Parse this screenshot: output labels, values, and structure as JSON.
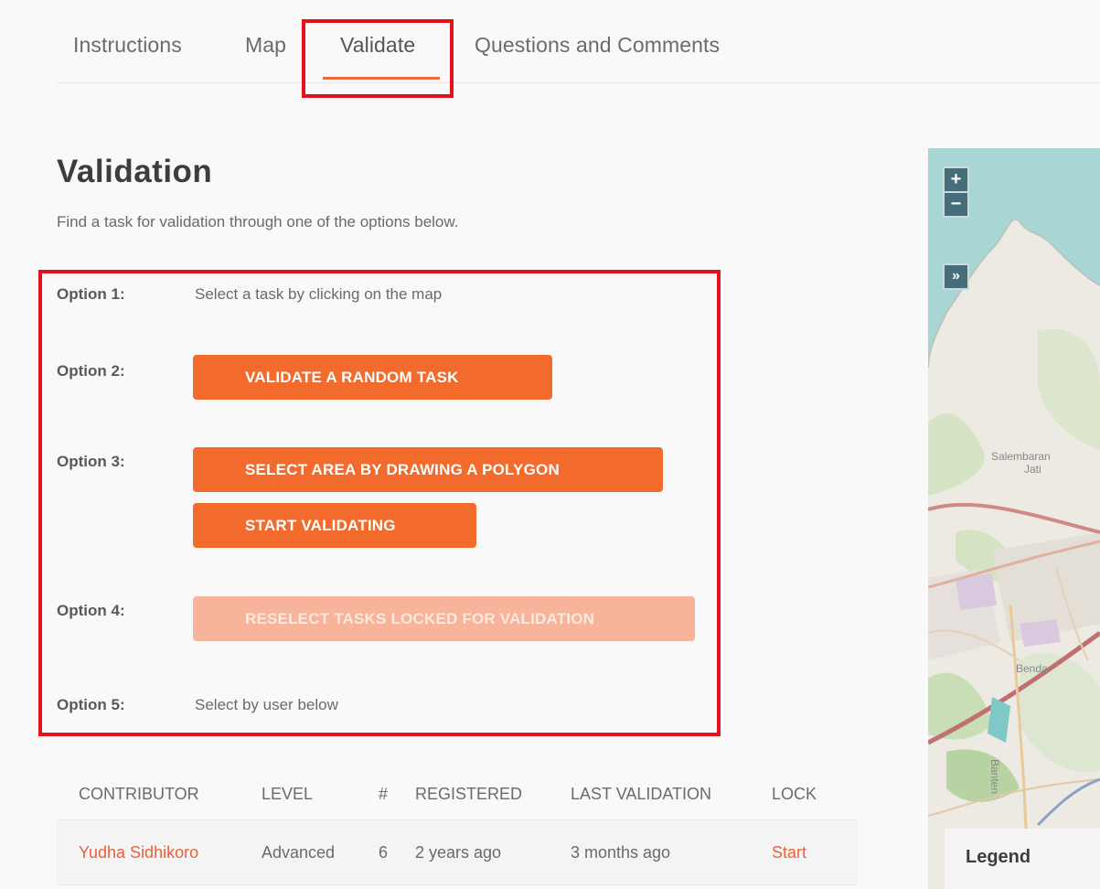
{
  "tabs": [
    {
      "label": "Instructions"
    },
    {
      "label": "Map"
    },
    {
      "label": "Validate"
    },
    {
      "label": "Questions and Comments"
    }
  ],
  "active_tab": "Validate",
  "validation": {
    "title": "Validation",
    "subtitle": "Find a task for validation through one of the options below.",
    "options": [
      {
        "label": "Option 1:",
        "text": "Select a task by clicking on the map"
      },
      {
        "label": "Option 2:",
        "button": "VALIDATE A RANDOM TASK"
      },
      {
        "label": "Option 3:",
        "button": "SELECT AREA BY DRAWING A POLYGON",
        "button2": "START VALIDATING"
      },
      {
        "label": "Option 4:",
        "button": "RESELECT TASKS LOCKED FOR VALIDATION",
        "disabled": true
      },
      {
        "label": "Option 5:",
        "text": "Select by user below"
      }
    ]
  },
  "table": {
    "headers": [
      "CONTRIBUTOR",
      "LEVEL",
      "#",
      "REGISTERED",
      "LAST VALIDATION",
      "LOCK"
    ],
    "rows": [
      {
        "contributor": "Yudha Sidhikoro",
        "level": "Advanced",
        "count": "6",
        "registered": "2 years ago",
        "last_validation": "3 months ago",
        "lock": "Start"
      }
    ]
  },
  "map": {
    "zoom_in": "+",
    "zoom_out": "−",
    "expand": "»",
    "labels": [
      "Salembaran",
      "Jati",
      "Benda",
      "Banten"
    ],
    "legend": "Legend"
  },
  "colors": {
    "accent": "#f36a2d",
    "highlight": "#e4131b",
    "link": "#e8623a"
  }
}
